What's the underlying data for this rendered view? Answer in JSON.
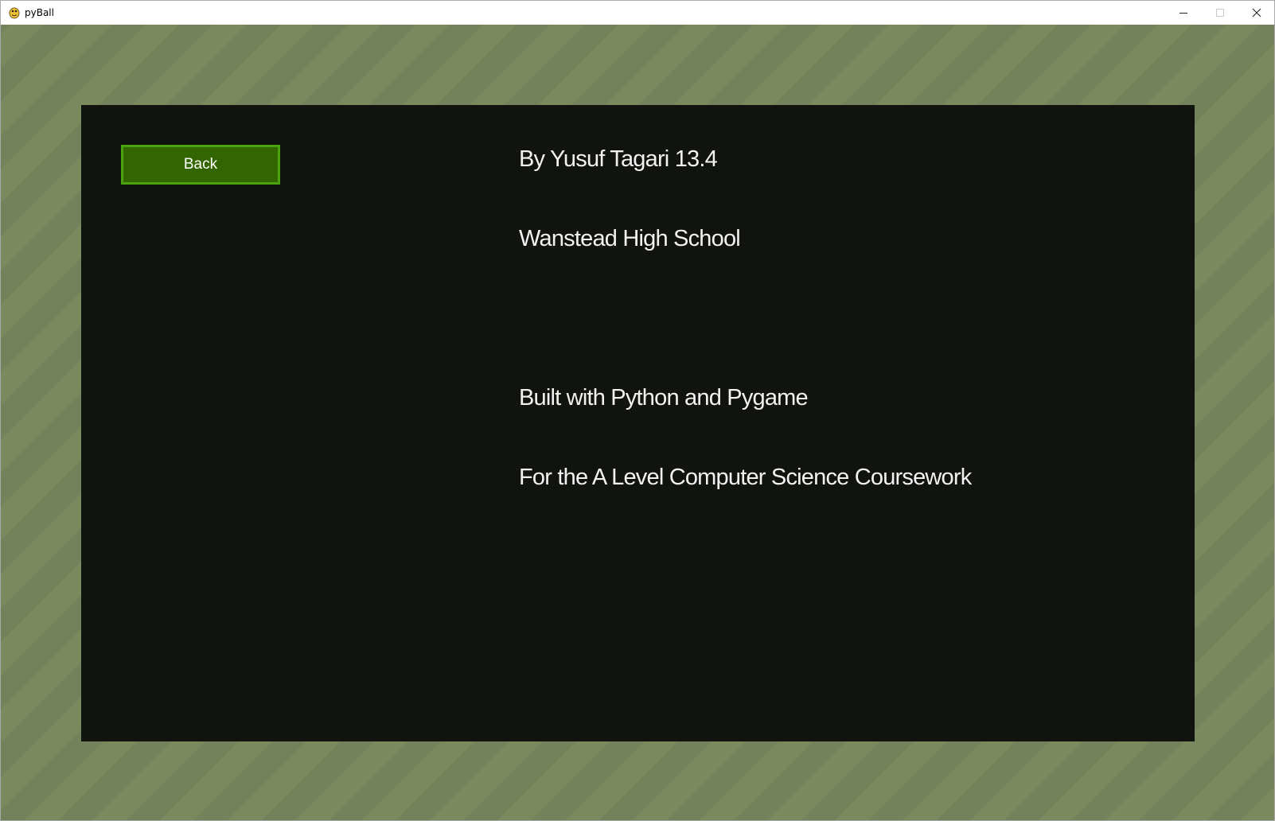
{
  "window": {
    "title": "pyBall",
    "controls": {
      "minimize_icon": "minimize-icon",
      "maximize_icon": "maximize-icon",
      "close_icon": "close-icon"
    }
  },
  "app": {
    "icon": "pygame-snake-icon",
    "back_label": "Back",
    "credits": {
      "author": "By Yusuf Tagari 13.4",
      "school": "Wanstead High School",
      "built_with": "Built with Python and Pygame",
      "purpose": "For the A Level Computer Science Coursework"
    }
  },
  "colors": {
    "background_stripe_a": "#7b8a5e",
    "background_stripe_b": "#73825a",
    "panel": "#10130e",
    "button_fill": "#336600",
    "button_border": "#4aa30e",
    "text": "#f2f2f2"
  }
}
